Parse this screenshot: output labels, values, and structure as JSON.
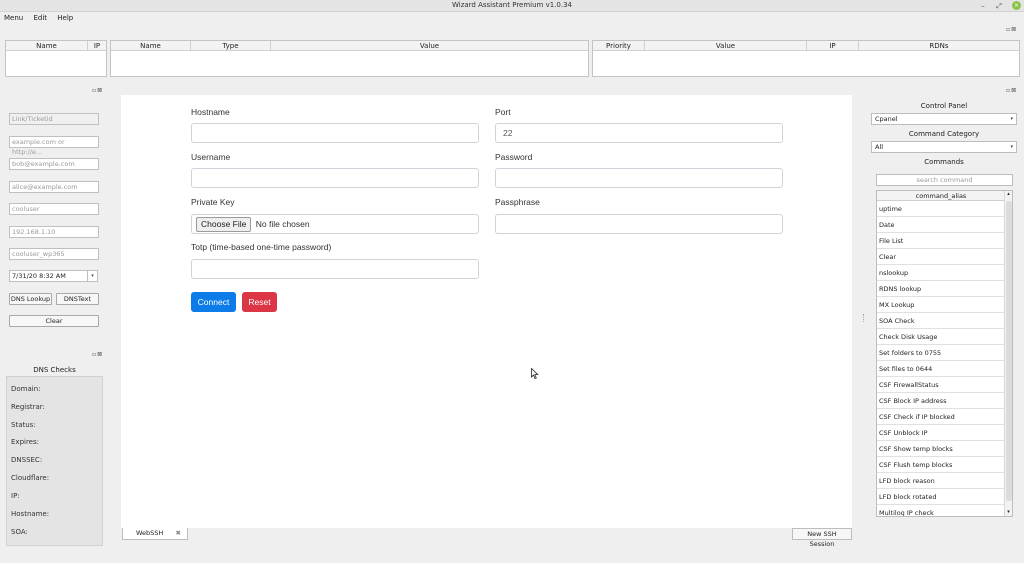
{
  "window": {
    "title": "Wizard Assistant Premium v1.0.34",
    "btn_min": "–",
    "btn_max": "⤢",
    "btn_close": "×"
  },
  "menubar": {
    "items": [
      "Menu",
      "Edit",
      "Help"
    ]
  },
  "dock": {
    "float": "▫",
    "close": "⊠"
  },
  "top_tables": {
    "t1": [
      "Name",
      "IP"
    ],
    "t2": [
      "Name",
      "Type",
      "Value"
    ],
    "t3": [
      "Priority",
      "Value",
      "IP",
      "RDNs"
    ]
  },
  "left_panel": {
    "link_ticket": "Link/Ticketid",
    "domain": "example.com or http://e...",
    "email1": "bob@example.com",
    "email2": "alice@example.com",
    "user": "cooluser",
    "ip": "192.168.1.10",
    "user_wp": "cooluser_wp365",
    "datetime": "7/31/20 8:32 AM",
    "datetime_arrow": "▾",
    "dns_lookup": "DNS Lookup",
    "dns_text": "DNSText",
    "clear": "Clear"
  },
  "dns_checks": {
    "title": "DNS Checks",
    "rows": [
      "Domain:",
      "Registrar:",
      "Status:",
      "Expires:",
      "DNSSEC:",
      "Cloudflare:",
      "IP:",
      "Hostname:",
      "SOA:"
    ]
  },
  "ssh_form": {
    "hostname_label": "Hostname",
    "port_label": "Port",
    "port_value": "22",
    "username_label": "Username",
    "password_label": "Password",
    "private_key_label": "Private Key",
    "choose_file": "Choose File",
    "no_file": "No file chosen",
    "passphrase_label": "Passphrase",
    "totp_label": "Totp (time-based one-time password)",
    "connect": "Connect",
    "reset": "Reset",
    "connect_color": "#0d7ce8",
    "reset_color": "#dc3545"
  },
  "tabs": {
    "webssh": "WebSSH",
    "tab_close": "✖",
    "new_session": "New SSH Session"
  },
  "right_panel": {
    "control_panel_title": "Control Panel",
    "control_panel_value": "Cpanel",
    "category_title": "Command Category",
    "category_value": "All",
    "commands_title": "Commands",
    "search_placeholder": "search command",
    "list_header": "command_alias",
    "commands": [
      "uptime",
      "Date",
      "File List",
      "Clear",
      "nslookup",
      "RDNS lookup",
      "MX Lookup",
      "SOA Check",
      "Check Disk Usage",
      "Set folders to 0755",
      "Set files to 0644",
      "CSF FirewallStatus",
      "CSF Block IP address",
      "CSF Check if IP blocked",
      "CSF Unblock IP",
      "CSF Show temp blocks",
      "CSF Flush temp blocks",
      "LFD block reason",
      "LFD block rotated",
      "Multilog IP check"
    ],
    "select_arrow": "▾",
    "scroll_up": "▴",
    "scroll_down": "▾"
  }
}
